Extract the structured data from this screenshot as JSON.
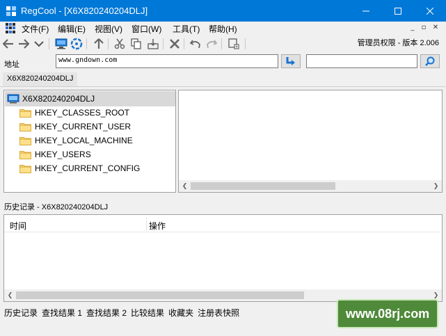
{
  "window": {
    "title": "RegCool - [X6X820240204DLJ]",
    "title_bg": "#0078d7"
  },
  "menu": {
    "items": [
      "文件(F)",
      "编辑(E)",
      "视图(V)",
      "窗口(W)",
      "工具(T)",
      "帮助(H)"
    ]
  },
  "toolbar": {
    "admin_version": "管理员权限 - 版本 2.006",
    "icons": [
      "back-arrow-icon",
      "forward-arrow-icon",
      "dropdown-chevron-icon",
      "computer-icon",
      "network-registry-icon",
      "up-arrow-icon",
      "cut-icon",
      "copy-icon",
      "export-icon",
      "delete-icon",
      "undo-icon",
      "redo-icon",
      "new-key-icon"
    ]
  },
  "address": {
    "label": "地址",
    "value": "www.gndown.com"
  },
  "tabs": [
    "X6X820240204DLJ"
  ],
  "tree": {
    "root": "X6X820240204DLJ",
    "hives": [
      "HKEY_CLASSES_ROOT",
      "HKEY_CURRENT_USER",
      "HKEY_LOCAL_MACHINE",
      "HKEY_USERS",
      "HKEY_CURRENT_CONFIG"
    ]
  },
  "history": {
    "label": "历史记录 - X6X820240204DLJ",
    "columns": [
      "时间",
      "操作"
    ]
  },
  "bottom_tabs": [
    "历史记录",
    "查找结果 1",
    "查找结果 2",
    "比较结果",
    "收藏夹",
    "注册表快照"
  ],
  "watermark": "www.08rj.com"
}
